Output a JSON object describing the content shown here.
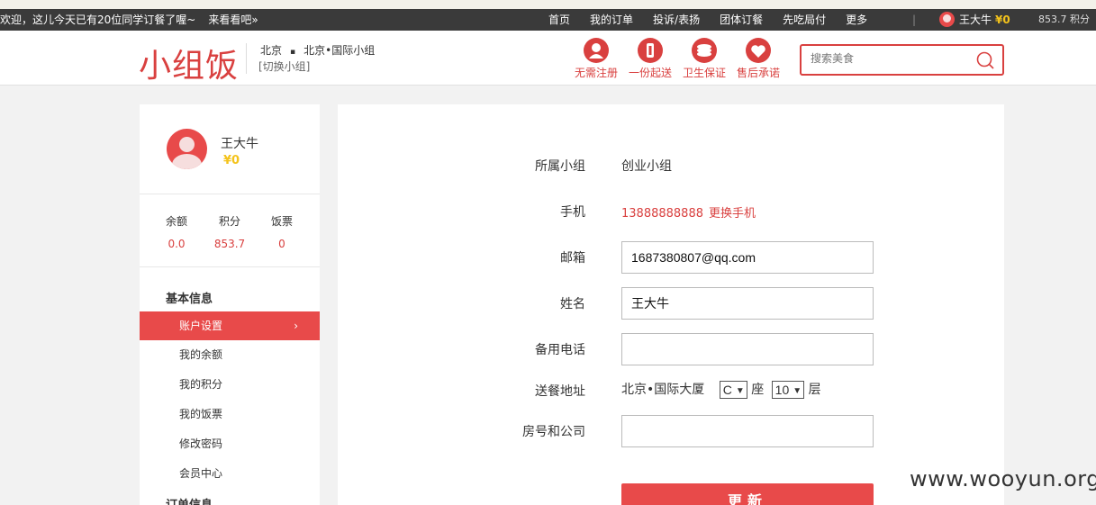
{
  "topbar": {
    "ticker": "欢迎，这儿今天已有20位同学订餐了喔~",
    "ticker_link": "来看看吧»",
    "nav": [
      "首页",
      "我的订单",
      "投诉/表扬",
      "团体订餐",
      "先吃局付",
      "更多"
    ],
    "separator": "|",
    "user_name": "王大牛",
    "coin": "¥0",
    "points": "853.7 积分"
  },
  "header": {
    "logo": "小组饭",
    "city": "北京",
    "dot": "▪",
    "group": "北京•国际小组",
    "switch": "[切换小组]",
    "features": [
      {
        "label": "无需注册",
        "icon": "user-icon"
      },
      {
        "label": "一份起送",
        "icon": "one-icon"
      },
      {
        "label": "卫生保证",
        "icon": "shield-icon"
      },
      {
        "label": "售后承诺",
        "icon": "heart-icon"
      }
    ],
    "search_placeholder": "搜索美食"
  },
  "sidebar": {
    "name": "王大牛",
    "coin": "¥0",
    "stats": [
      {
        "label": "余额",
        "value": "0.0"
      },
      {
        "label": "积分",
        "value": "853.7"
      },
      {
        "label": "饭票",
        "value": "0"
      }
    ],
    "section1": "基本信息",
    "items": [
      "账户设置",
      "我的余额",
      "我的积分",
      "我的饭票",
      "修改密码",
      "会员中心"
    ],
    "chevron": "›",
    "section2": "订单信息"
  },
  "form": {
    "group_label": "所属小组",
    "group_value": "创业小组",
    "phone_label": "手机",
    "phone_value": "13888888888",
    "phone_change": "更换手机",
    "email_label": "邮箱",
    "email_value": "1687380807@qq.com",
    "name_label": "姓名",
    "name_value": "王大牛",
    "backup_label": "备用电话",
    "backup_value": "",
    "address_label": "送餐地址",
    "address_building": "北京•国际大厦",
    "seat_value": "C",
    "seat_unit": "座",
    "floor_value": "10",
    "floor_unit": "层",
    "room_label": "房号和公司",
    "room_value": "",
    "submit": "更新"
  },
  "watermark": "www.wooyun.org",
  "colors": {
    "accent": "#e84a4a",
    "topbar": "#3a3a3a",
    "coin": "#f4c31b"
  }
}
